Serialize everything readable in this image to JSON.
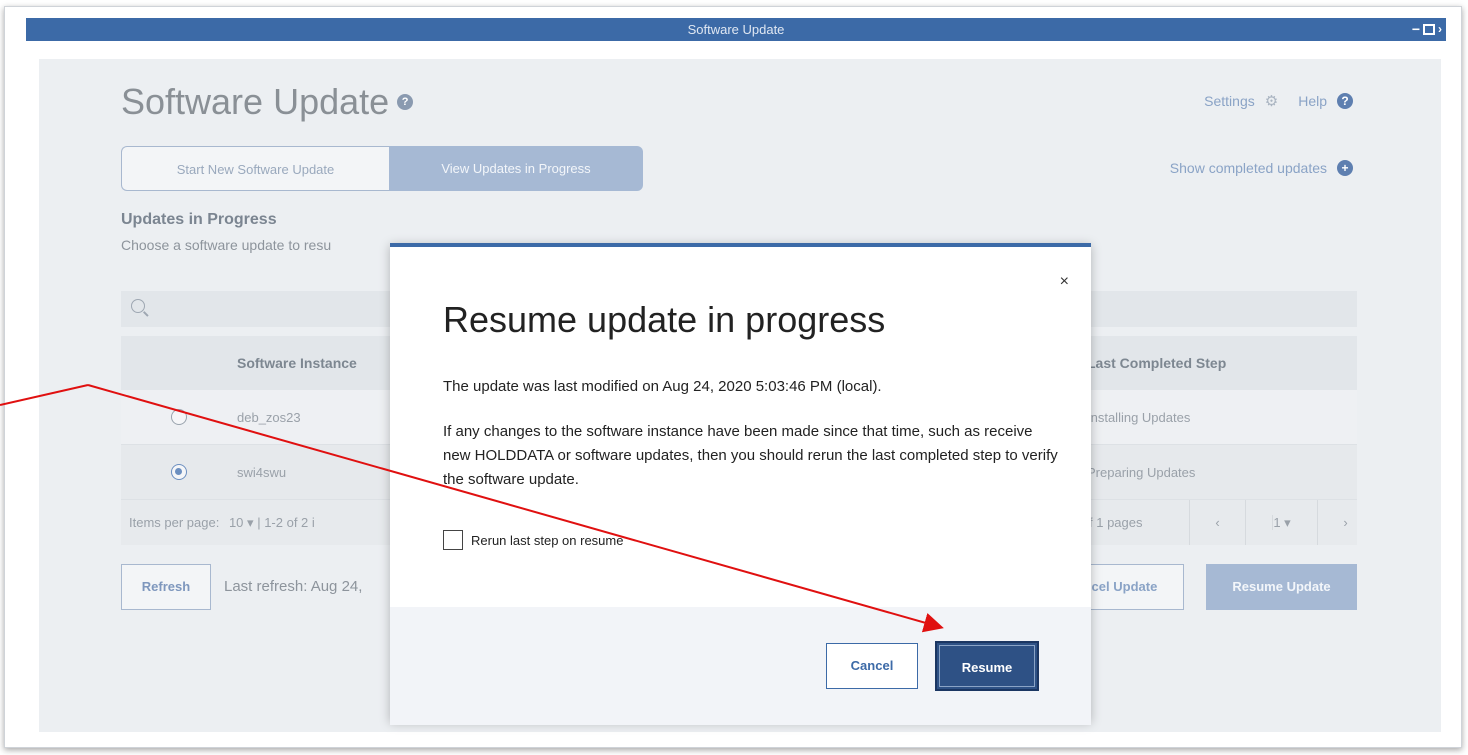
{
  "window": {
    "title": "Software Update",
    "controls": [
      "minimize-icon",
      "maximize-icon",
      "close-icon"
    ]
  },
  "header": {
    "title": "Software Update",
    "help_icon": "help-icon",
    "settings_label": "Settings",
    "help_label": "Help",
    "show_completed_label": "Show completed updates"
  },
  "tabs": [
    {
      "label": "Start New Software Update"
    },
    {
      "label": "View Updates in Progress"
    }
  ],
  "section": {
    "title": "Updates in Progress",
    "subtitle": "Choose a software update to resu"
  },
  "search": {
    "icon": "search-icon",
    "placeholder": ""
  },
  "table": {
    "columns": [
      "Software Instance",
      "Last Completed Step"
    ],
    "rows": [
      {
        "instance": "deb_zos23",
        "step": "Installing Updates",
        "selected": false
      },
      {
        "instance": "swi4swu",
        "step": "Preparing Updates",
        "selected": true
      }
    ]
  },
  "pagination": {
    "items_label": "Items per page:",
    "items_value": "10",
    "range": "1-2 of 2 i",
    "pages_text": "f 1 pages",
    "current_page": "1"
  },
  "actions": {
    "refresh_label": "Refresh",
    "last_refresh": "Last refresh: Aug 24,",
    "cancel_update_label": "Cancel Update",
    "resume_update_label": "Resume Update"
  },
  "modal": {
    "title": "Resume update in progress",
    "close_label": "×",
    "paragraph1": "The update was last modified on Aug 24, 2020 5:03:46 PM (local).",
    "paragraph2": "If any changes to the software instance have been made since that time, such as receive new HOLDDATA or software updates, then you should rerun the last completed step to verify the software update.",
    "checkbox_label": "Rerun last step on resume",
    "checkbox_checked": false,
    "cancel_label": "Cancel",
    "resume_label": "Resume"
  },
  "colors": {
    "titlebar": "#3c6aa7",
    "primary_button": "#2e5185",
    "annotation_arrow": "#e01010"
  }
}
